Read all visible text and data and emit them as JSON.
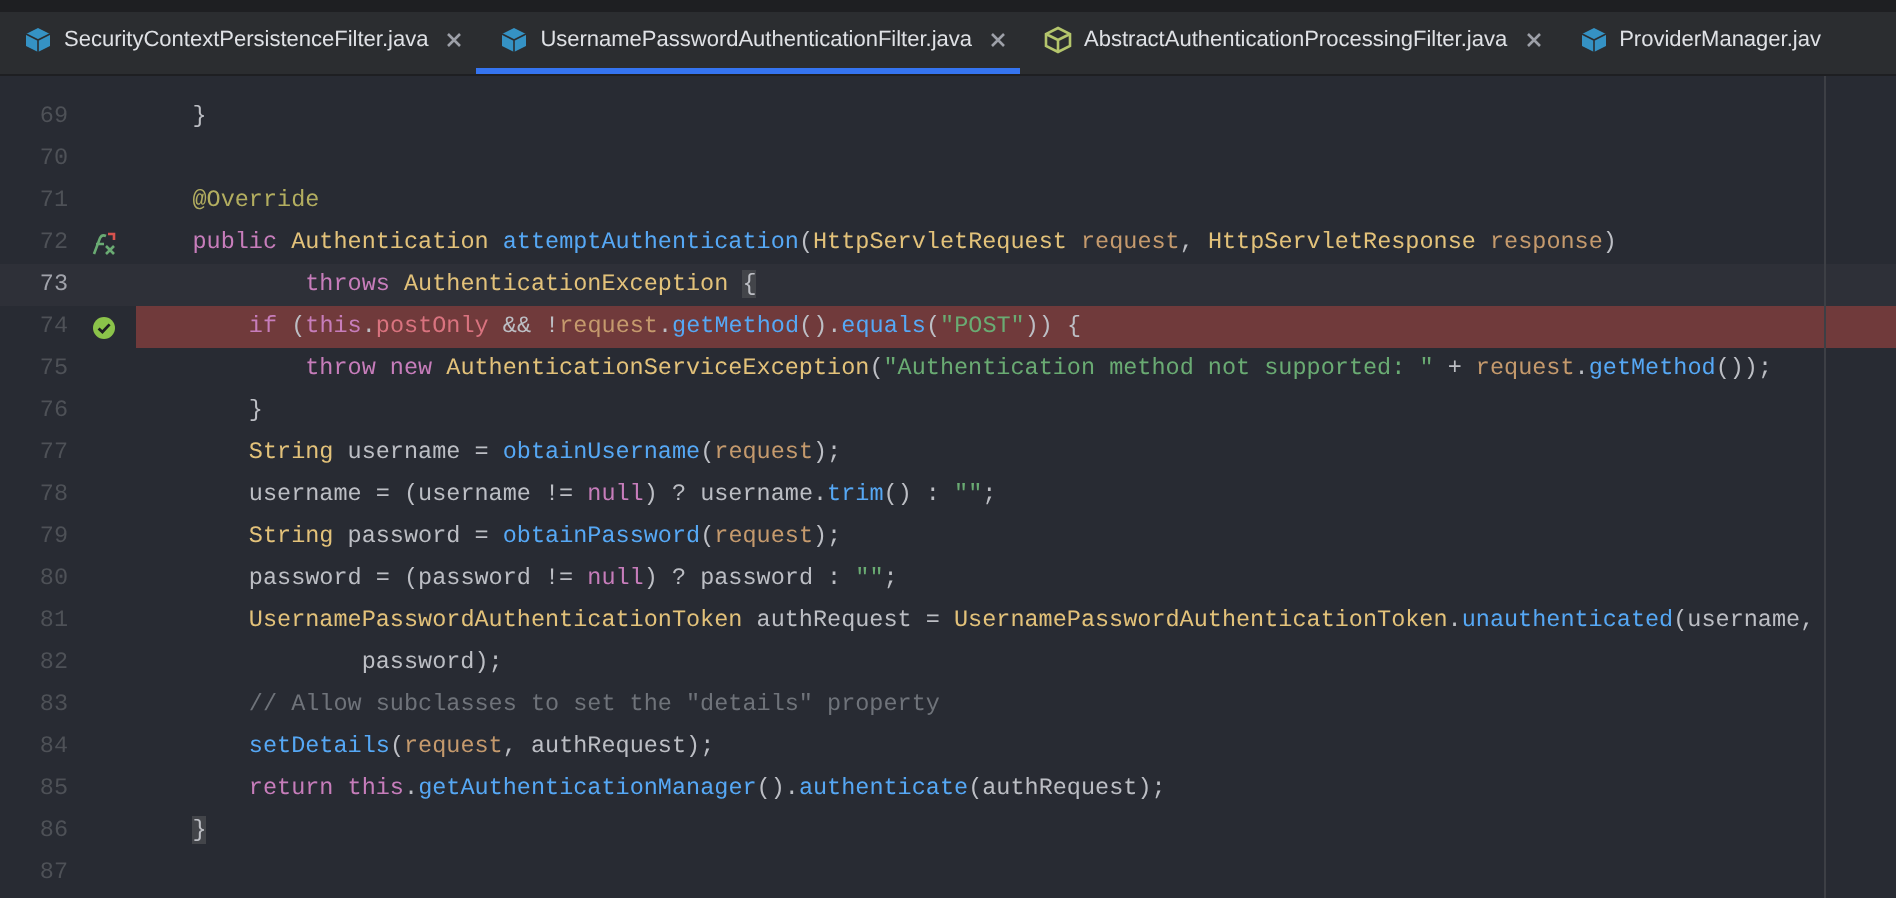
{
  "tabs": [
    {
      "label": "SecurityContextPersistenceFilter.java",
      "selected": false,
      "kind": "class"
    },
    {
      "label": "UsernamePasswordAuthenticationFilter.java",
      "selected": true,
      "kind": "class"
    },
    {
      "label": "AbstractAuthenticationProcessingFilter.java",
      "selected": false,
      "kind": "abstract"
    },
    {
      "label": "ProviderManager.jav",
      "selected": false,
      "kind": "class"
    }
  ],
  "editor": {
    "lines": [
      {
        "number": "69",
        "current": false,
        "breakpoint": false,
        "tokens": [
          {
            "text": "    }",
            "kind": "plain"
          }
        ]
      },
      {
        "number": "70",
        "current": false,
        "breakpoint": false
      },
      {
        "number": "71",
        "current": false,
        "breakpoint": false,
        "tokens": [
          {
            "text": "    @Override",
            "kind": "annotation"
          }
        ]
      },
      {
        "number": "72",
        "current": false,
        "breakpoint": false,
        "gutter_icon": {
          "kind": "override"
        },
        "tokens": [
          {
            "text": "    public ",
            "kind": "keyword"
          },
          {
            "text": "Authentication ",
            "kind": "type"
          },
          {
            "text": "attemptAuthentication",
            "kind": "method"
          },
          {
            "text": "(",
            "kind": "plain"
          },
          {
            "text": "HttpServletRequest ",
            "kind": "type"
          },
          {
            "text": "request",
            "kind": "param"
          },
          {
            "text": ", ",
            "kind": "plain"
          },
          {
            "text": "HttpServletResponse ",
            "kind": "type"
          },
          {
            "text": "response",
            "kind": "param"
          },
          {
            "text": ")",
            "kind": "plain"
          }
        ]
      },
      {
        "number": "73",
        "current": true,
        "breakpoint": false,
        "tokens": [
          {
            "text": "            throws ",
            "kind": "keyword"
          },
          {
            "text": "AuthenticationException ",
            "kind": "type"
          },
          {
            "text": "{",
            "kind": "brace_match"
          }
        ]
      },
      {
        "number": "74",
        "current": false,
        "breakpoint": true,
        "gutter_icon": {
          "kind": "breakpoint"
        },
        "tokens": [
          {
            "text": "        if ",
            "kind": "keyword"
          },
          {
            "text": "(",
            "kind": "plain"
          },
          {
            "text": "this",
            "kind": "keyword"
          },
          {
            "text": ".",
            "kind": "plain"
          },
          {
            "text": "postOnly",
            "kind": "field"
          },
          {
            "text": " && !",
            "kind": "plain"
          },
          {
            "text": "request",
            "kind": "param"
          },
          {
            "text": ".",
            "kind": "plain"
          },
          {
            "text": "getMethod",
            "kind": "method"
          },
          {
            "text": "().",
            "kind": "plain"
          },
          {
            "text": "equals",
            "kind": "method"
          },
          {
            "text": "(",
            "kind": "plain"
          },
          {
            "text": "\"POST\"",
            "kind": "string"
          },
          {
            "text": ")) {",
            "kind": "plain"
          }
        ]
      },
      {
        "number": "75",
        "current": false,
        "breakpoint": false,
        "tokens": [
          {
            "text": "            throw new ",
            "kind": "keyword"
          },
          {
            "text": "AuthenticationServiceException",
            "kind": "type"
          },
          {
            "text": "(",
            "kind": "plain"
          },
          {
            "text": "\"Authentication method not supported: \"",
            "kind": "string"
          },
          {
            "text": " + ",
            "kind": "plain"
          },
          {
            "text": "request",
            "kind": "param"
          },
          {
            "text": ".",
            "kind": "plain"
          },
          {
            "text": "getMethod",
            "kind": "method"
          },
          {
            "text": "());",
            "kind": "plain"
          }
        ]
      },
      {
        "number": "76",
        "current": false,
        "breakpoint": false,
        "tokens": [
          {
            "text": "        }",
            "kind": "plain"
          }
        ]
      },
      {
        "number": "77",
        "current": false,
        "breakpoint": false,
        "tokens": [
          {
            "text": "        String ",
            "kind": "type"
          },
          {
            "text": "username = ",
            "kind": "plain"
          },
          {
            "text": "obtainUsername",
            "kind": "method"
          },
          {
            "text": "(",
            "kind": "plain"
          },
          {
            "text": "request",
            "kind": "param"
          },
          {
            "text": ");",
            "kind": "plain"
          }
        ]
      },
      {
        "number": "78",
        "current": false,
        "breakpoint": false,
        "tokens": [
          {
            "text": "        username = (username != ",
            "kind": "plain"
          },
          {
            "text": "null",
            "kind": "keyword"
          },
          {
            "text": ") ? username.",
            "kind": "plain"
          },
          {
            "text": "trim",
            "kind": "method"
          },
          {
            "text": "() : ",
            "kind": "plain"
          },
          {
            "text": "\"\"",
            "kind": "string"
          },
          {
            "text": ";",
            "kind": "plain"
          }
        ]
      },
      {
        "number": "79",
        "current": false,
        "breakpoint": false,
        "tokens": [
          {
            "text": "        String ",
            "kind": "type"
          },
          {
            "text": "password = ",
            "kind": "plain"
          },
          {
            "text": "obtainPassword",
            "kind": "method"
          },
          {
            "text": "(",
            "kind": "plain"
          },
          {
            "text": "request",
            "kind": "param"
          },
          {
            "text": ");",
            "kind": "plain"
          }
        ]
      },
      {
        "number": "80",
        "current": false,
        "breakpoint": false,
        "tokens": [
          {
            "text": "        password = (password != ",
            "kind": "plain"
          },
          {
            "text": "null",
            "kind": "keyword"
          },
          {
            "text": ") ? password : ",
            "kind": "plain"
          },
          {
            "text": "\"\"",
            "kind": "string"
          },
          {
            "text": ";",
            "kind": "plain"
          }
        ]
      },
      {
        "number": "81",
        "current": false,
        "breakpoint": false,
        "tokens": [
          {
            "text": "        UsernamePasswordAuthenticationToken ",
            "kind": "type"
          },
          {
            "text": "authRequest = ",
            "kind": "plain"
          },
          {
            "text": "UsernamePasswordAuthenticationToken",
            "kind": "type"
          },
          {
            "text": ".",
            "kind": "plain"
          },
          {
            "text": "unauthenticated",
            "kind": "method"
          },
          {
            "text": "(username,",
            "kind": "plain"
          }
        ]
      },
      {
        "number": "82",
        "current": false,
        "breakpoint": false,
        "tokens": [
          {
            "text": "                password);",
            "kind": "plain"
          }
        ]
      },
      {
        "number": "83",
        "current": false,
        "breakpoint": false,
        "tokens": [
          {
            "text": "        // Allow subclasses to set the \"details\" property",
            "kind": "comment"
          }
        ]
      },
      {
        "number": "84",
        "current": false,
        "breakpoint": false,
        "tokens": [
          {
            "text": "        setDetails",
            "kind": "method"
          },
          {
            "text": "(",
            "kind": "plain"
          },
          {
            "text": "request",
            "kind": "param"
          },
          {
            "text": ", authRequest);",
            "kind": "plain"
          }
        ]
      },
      {
        "number": "85",
        "current": false,
        "breakpoint": false,
        "tokens": [
          {
            "text": "        return this",
            "kind": "keyword"
          },
          {
            "text": ".",
            "kind": "plain"
          },
          {
            "text": "getAuthenticationManager",
            "kind": "method"
          },
          {
            "text": "().",
            "kind": "plain"
          },
          {
            "text": "authenticate",
            "kind": "method"
          },
          {
            "text": "(authRequest);",
            "kind": "plain"
          }
        ]
      },
      {
        "number": "86",
        "current": false,
        "breakpoint": false,
        "tokens": [
          {
            "text": "    }",
            "kind": "brace_match"
          }
        ]
      },
      {
        "number": "87",
        "current": false,
        "breakpoint": false
      }
    ]
  }
}
